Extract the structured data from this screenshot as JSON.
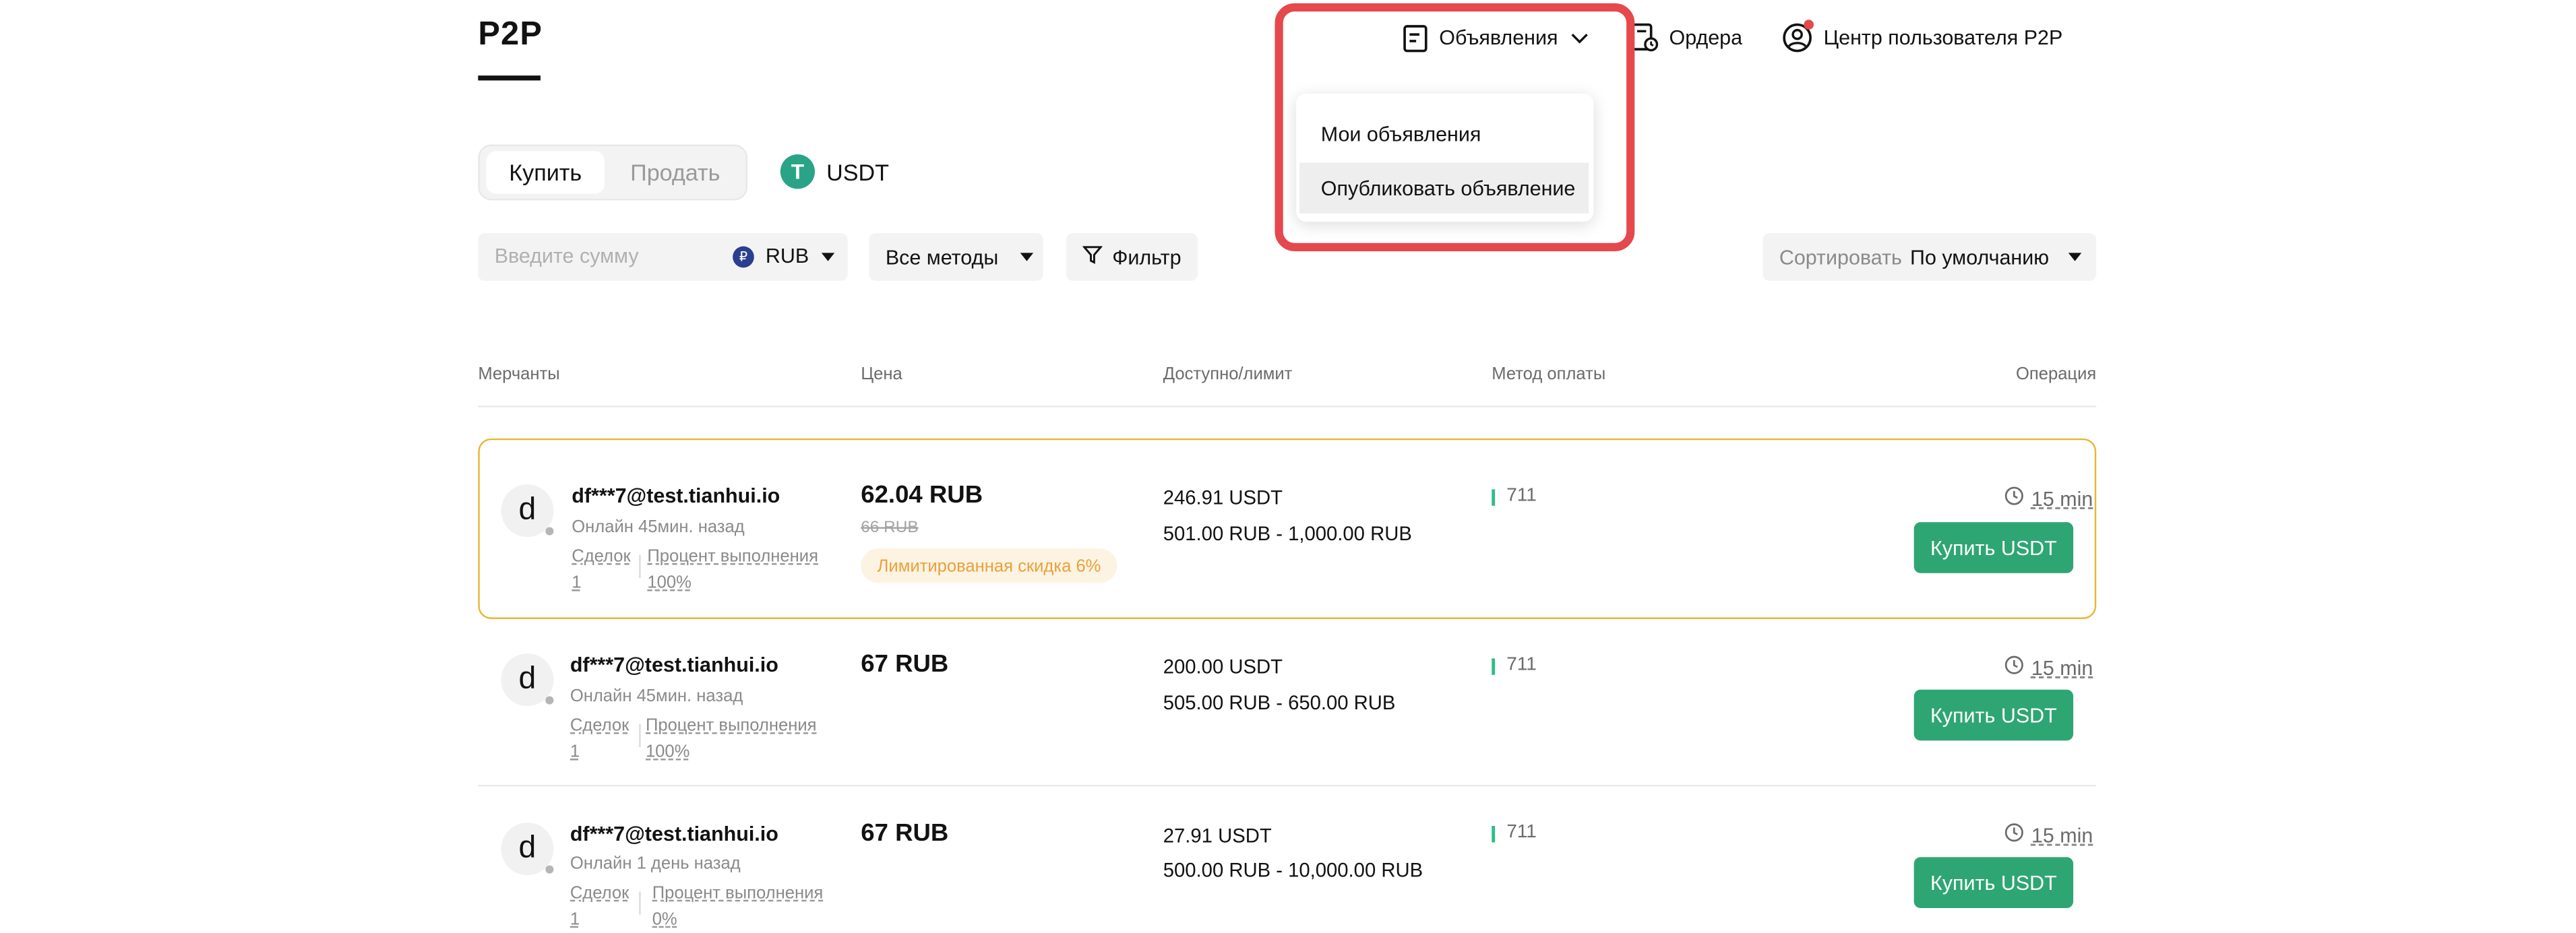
{
  "header": {
    "title": "P2P",
    "nav": {
      "ads_label": "Объявления",
      "orders_label": "Ордера",
      "user_center_label": "Центр пользователя P2P"
    }
  },
  "ads_dropdown": {
    "items": [
      "Мои объявления",
      "Опубликовать объявление"
    ]
  },
  "trade_tabs": {
    "buy": "Купить",
    "sell": "Продать"
  },
  "coin": {
    "symbol": "USDT",
    "icon_letter": "T"
  },
  "filters": {
    "amount_placeholder": "Введите сумму",
    "currency_symbol": "₽",
    "currency": "RUB",
    "methods": "Все методы",
    "filter": "Фильтр",
    "sort_label": "Сортировать",
    "sort_value": "По умолчанию"
  },
  "table": {
    "headers": {
      "merchants": "Мерчанты",
      "price": "Цена",
      "available": "Доступно/лимит",
      "payment": "Метод оплаты",
      "operation": "Операция"
    },
    "rows": [
      {
        "avatar": "d",
        "merchant": "df***7@test.tianhui.io",
        "status": "Онлайн 45мин. назад",
        "deals_label": "Сделок",
        "deals_value": "1",
        "completion_label": "Процент выполнения",
        "completion_value": "100%",
        "price": "62.04 RUB",
        "old_price": "66 RUB",
        "badge": "Лимитированная скидка 6%",
        "available": "246.91 USDT",
        "limit": "501.00 RUB - 1,000.00 RUB",
        "payment": "711",
        "time": "15 min",
        "button": "Купить USDT"
      },
      {
        "avatar": "d",
        "merchant": "df***7@test.tianhui.io",
        "status": "Онлайн 45мин. назад",
        "deals_label": "Сделок",
        "deals_value": "1",
        "completion_label": "Процент выполнения",
        "completion_value": "100%",
        "price": "67 RUB",
        "available": "200.00 USDT",
        "limit": "505.00 RUB - 650.00 RUB",
        "payment": "711",
        "time": "15 min",
        "button": "Купить USDT"
      },
      {
        "avatar": "d",
        "merchant": "df***7@test.tianhui.io",
        "status": "Онлайн 1 день назад",
        "deals_label": "Сделок",
        "deals_value": "1",
        "completion_label": "Процент выполнения",
        "completion_value": "0%",
        "price": "67 RUB",
        "available": "27.91 USDT",
        "limit": "500.00 RUB - 10,000.00 RUB",
        "payment": "711",
        "time": "15 min",
        "button": "Купить USDT"
      }
    ]
  },
  "colors": {
    "accent_green": "#2ea673",
    "highlight_red": "#e5484d",
    "featured_border": "#e9b637",
    "tether_green": "#2aa486"
  }
}
